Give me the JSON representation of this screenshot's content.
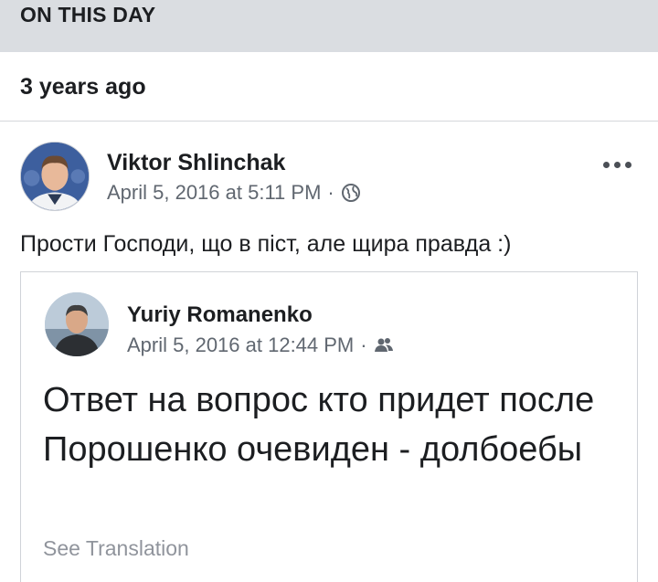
{
  "section": {
    "title": "ON THIS DAY",
    "subtitle": "3 years ago"
  },
  "post": {
    "author": "Viktor Shlinchak",
    "timestamp": "April 5, 2016 at 5:11 PM",
    "separator": "·",
    "privacy_icon": "globe-icon",
    "more_icon": "ellipsis-icon",
    "text": "Прости Господи, що в піст, але щира правда :)"
  },
  "shared_post": {
    "author": "Yuriy Romanenko",
    "timestamp": "April 5, 2016 at 12:44 PM",
    "separator": "·",
    "privacy_icon": "friends-icon",
    "text": "Ответ на вопрос кто придет после Порошенко очевиден - долбоебы",
    "translation_link": "See Translation"
  },
  "colors": {
    "header_bg": "#dadde1",
    "meta_text": "#606770",
    "link_muted": "#90949c"
  }
}
